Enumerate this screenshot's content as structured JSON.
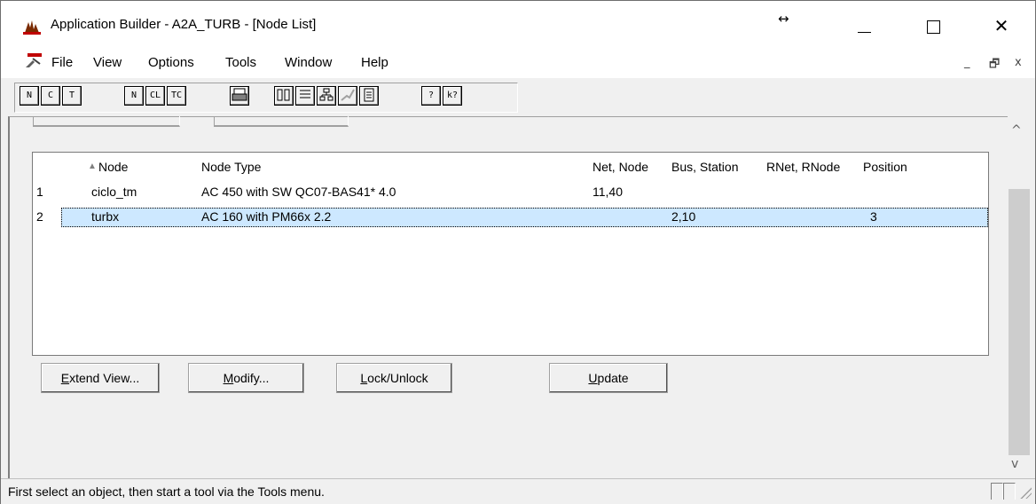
{
  "window": {
    "title": "Application Builder - A2A_TURB - [Node List]",
    "resize_indicator": "↔",
    "close_glyph": "✕"
  },
  "menu": {
    "items": [
      "File",
      "View",
      "Options",
      "Tools",
      "Window",
      "Help"
    ],
    "mdi_min": "_",
    "mdi_restore": "🗗",
    "mdi_close": "x"
  },
  "toolbar": {
    "buttons": [
      "N",
      "C",
      "T",
      "N",
      "CL",
      "TC",
      "print",
      "sysconf",
      "list",
      "tree",
      "chart",
      "doc",
      "?",
      "k?"
    ]
  },
  "list": {
    "sort_arrow": "▲",
    "columns": [
      "Node",
      "Node Type",
      "Net, Node",
      "Bus, Station",
      "RNet, RNode",
      "Position"
    ],
    "rows": [
      {
        "index": "1",
        "node": "ciclo_tm",
        "node_type": "AC 450 with SW QC07-BAS41* 4.0",
        "net_node": "11,40",
        "bus_station": "",
        "rnet_rnode": "",
        "position": ""
      },
      {
        "index": "2",
        "node": "turbx",
        "node_type": "AC 160 with PM66x 2.2",
        "net_node": "",
        "bus_station": "2,10",
        "rnet_rnode": "",
        "position": "3"
      }
    ]
  },
  "buttons": {
    "extend_view": {
      "mnemonic": "E",
      "rest": "xtend View..."
    },
    "modify": {
      "mnemonic": "M",
      "rest": "odify..."
    },
    "lock_unlock": {
      "mnemonic": "L",
      "rest": "ock/Unlock"
    },
    "update": {
      "mnemonic": "U",
      "rest": "pdate"
    }
  },
  "scrollbar": {
    "up": "^",
    "down": "v"
  },
  "status": {
    "text": "First select an object, then start a tool via the Tools menu."
  }
}
